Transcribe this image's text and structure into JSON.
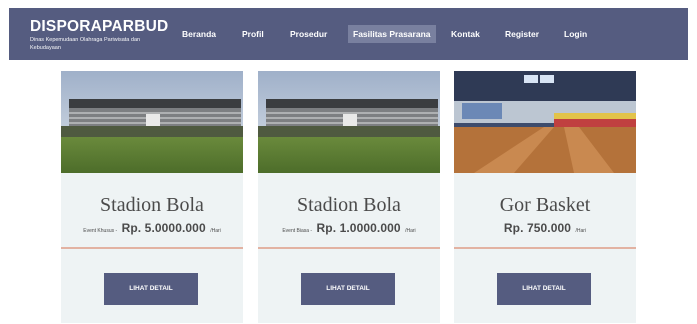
{
  "brand": {
    "title": "DISPORAPARBUD",
    "subtitle": "Dinas Kepemudaan Olahraga Pariwisata dan Kebudayaan"
  },
  "nav": {
    "items": [
      {
        "label": "Beranda"
      },
      {
        "label": "Profil"
      },
      {
        "label": "Prosedur"
      },
      {
        "label": "Fasilitas Prasarana",
        "active": true
      },
      {
        "label": "Kontak"
      },
      {
        "label": "Register"
      },
      {
        "label": "Login"
      }
    ]
  },
  "cards": [
    {
      "title": "Stadion Bola",
      "price_prefix": "Event Khusus -",
      "price": "Rp. 5.0000.000",
      "price_suffix": "/Hari",
      "button": "LIHAT DETAIL"
    },
    {
      "title": "Stadion Bola",
      "price_prefix": "Event Biasa -",
      "price": "Rp. 1.0000.000",
      "price_suffix": "/Hari",
      "button": "LIHAT DETAIL"
    },
    {
      "title": "Gor Basket",
      "price_prefix": "",
      "price": "Rp. 750.000",
      "price_suffix": "/Hari",
      "button": "LIHAT DETAIL"
    }
  ],
  "colors": {
    "navbar": "#555c80",
    "active_nav": "#79809f",
    "card_bg": "#eef3f4",
    "divider": "#e2b2a2",
    "button": "#555c80"
  }
}
